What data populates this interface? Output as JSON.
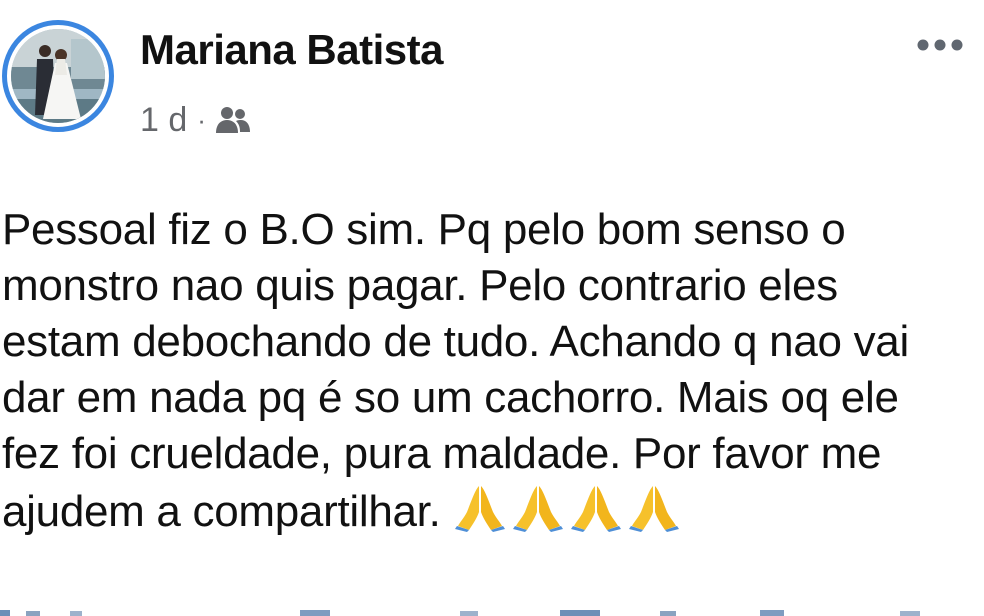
{
  "post": {
    "author": "Mariana Batista",
    "timestamp": "1 d",
    "separator": "·",
    "audience_icon": "friends-icon",
    "more_icon": "more-horizontal-icon",
    "text": "Pessoal fiz o B.O sim. Pq pelo bom senso o\nmonstro nao quis pagar. Pelo contrario eles\nestam debochando de tudo. Achando q nao vai\ndar em nada pq é so um cachorro. Mais oq ele\nfez foi crueldade, pura maldade. Por favor me\najudem a compartilhar.",
    "emoji": "🙏🙏🙏🙏",
    "emoji_icon": "folded-hands-icon",
    "accent_color": "#3b86e0"
  }
}
